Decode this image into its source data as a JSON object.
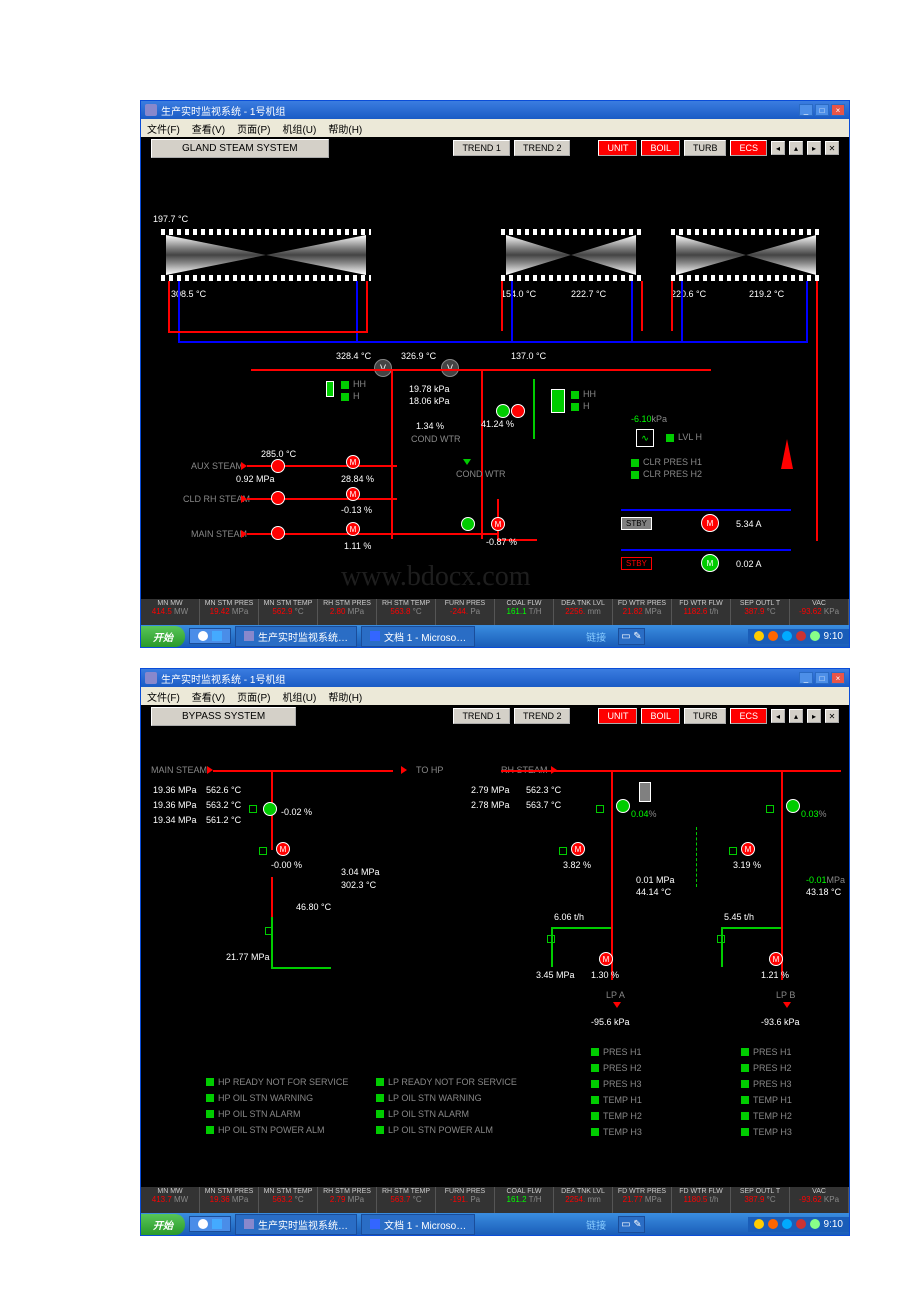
{
  "window_title": "生产实时监视系统 - 1号机组",
  "menu": {
    "file": "文件(F)",
    "view": "查看(V)",
    "page": "页面(P)",
    "unit": "机组(U)",
    "help": "帮助(H)"
  },
  "toolbar": {
    "trend1": "TREND 1",
    "trend2": "TREND 2",
    "unit": "UNIT",
    "boil": "BOIL",
    "turb": "TURB",
    "ecs": "ECS"
  },
  "screen1": {
    "title": "GLAND STEAM  SYSTEM",
    "t_hp_in": "197.7",
    "t_hp_out": "308.5",
    "t_ip1": "154.0",
    "t_ip2": "222.7",
    "t_lp1": "220.6",
    "t_lp2": "219.2",
    "t_hdr1": "328.4",
    "t_hdr2": "326.9",
    "t_hdr3": "137.0",
    "p1": "19.78",
    "p2": "18.06",
    "pct1": "1.34",
    "pct2": "41.24",
    "cond_wtr": "COND WTR",
    "aux_steam": "AUX STEAM",
    "aux_t": "285.0",
    "aux_p": "0.92",
    "aux_pct": "28.84",
    "cld_rh": "CLD RH STEAM",
    "cld_pct": "-0.13",
    "main_steam": "MAIN STEAM",
    "main_pct": "1.11",
    "main_pct2": "-0.87",
    "vac_p": "-6.10",
    "ind_hh": "HH",
    "ind_h": "H",
    "ind_lvlh": "LVL H",
    "ind_clr1": "CLR PRES H1",
    "ind_clr2": "CLR PRES H2",
    "stby": "STBY",
    "a1": "5.34",
    "a2": "0.02"
  },
  "status1": {
    "cols": [
      {
        "h": "MN MW",
        "v": "414.5",
        "u": "MW"
      },
      {
        "h": "MN STM PRES",
        "v": "19.42",
        "u": "MPa"
      },
      {
        "h": "MN STM TEMP",
        "v": "562.9",
        "u": "°C"
      },
      {
        "h": "RH STM PRES",
        "v": "2.80",
        "u": "MPa"
      },
      {
        "h": "RH STM TEMP",
        "v": "563.8",
        "u": "°C"
      },
      {
        "h": "FURN PRES",
        "v": "-244.",
        "u": "Pa"
      },
      {
        "h": "COAL FLW",
        "v": "161.1",
        "u": "T/H",
        "g": true
      },
      {
        "h": "DEA TNK LVL",
        "v": "2256.",
        "u": "mm"
      },
      {
        "h": "FD WTR PRES",
        "v": "21.82",
        "u": "MPa"
      },
      {
        "h": "FD WTR FLW",
        "v": "1182.6",
        "u": "t/h"
      },
      {
        "h": "SEP OUTL T",
        "v": "387.9",
        "u": "°C"
      },
      {
        "h": "VAC",
        "v": "-93.62",
        "u": "KPa"
      }
    ]
  },
  "screen2": {
    "title": "BYPASS  SYSTEM",
    "main_steam": "MAIN STEAM",
    "to_hp": "TO HP",
    "rh_steam": "RH STEAM",
    "ms_p1": "19.36",
    "ms_t1": "562.6",
    "ms_p2": "19.36",
    "ms_t2": "563.2",
    "ms_p3": "19.34",
    "ms_t3": "561.2",
    "hp_pct": "-0.02",
    "hp_m_pct": "-0.00",
    "hp_out_p": "3.04",
    "hp_out_t": "302.3",
    "hp_out_t2": "46.80",
    "hp_btm_p": "21.77",
    "rh_p1": "2.79",
    "rh_t1": "562.3",
    "rh_p2": "2.78",
    "rh_t2": "563.7",
    "lpa_pct": "0.04",
    "lpb_pct": "0.03",
    "lpa_m": "3.82",
    "lpb_m": "3.19",
    "lpa_p": "0.01",
    "lpa_t": "44.14",
    "lpb_p": "-0.01",
    "lpb_t": "43.18",
    "lpa_f": "6.06",
    "lpb_f": "5.45",
    "lpa_hdr": "3.45",
    "lpa_hdr_pct": "1.30",
    "lpb_hdr_pct": "1.21",
    "lpa_label": "LP A",
    "lpb_label": "LP B",
    "lpa_vac": "-95.6",
    "lpb_vac": "-93.6",
    "hp_ind": [
      "HP READY NOT FOR SERVICE",
      "HP OIL STN WARNING",
      "HP OIL STN ALARM",
      "HP OIL STN POWER ALM"
    ],
    "lp_ind": [
      "LP READY NOT FOR SERVICE",
      "LP OIL STN WARNING",
      "LP OIL STN ALARM",
      "LP OIL STN POWER ALM"
    ],
    "lpa_pres": [
      "PRES H1",
      "PRES H2",
      "PRES H3",
      "TEMP H1",
      "TEMP H2",
      "TEMP H3"
    ],
    "lpb_pres": [
      "PRES H1",
      "PRES H2",
      "PRES H3",
      "TEMP H1",
      "TEMP H2",
      "TEMP H3"
    ]
  },
  "status2": {
    "cols": [
      {
        "h": "MN MW",
        "v": "413.7",
        "u": "MW"
      },
      {
        "h": "MN STM PRES",
        "v": "19.36",
        "u": "MPa"
      },
      {
        "h": "MN STM TEMP",
        "v": "563.2",
        "u": "°C"
      },
      {
        "h": "RH STM PRES",
        "v": "2.79",
        "u": "MPa"
      },
      {
        "h": "RH STM TEMP",
        "v": "563.7",
        "u": "°C"
      },
      {
        "h": "FURN PRES",
        "v": "-191.",
        "u": "Pa"
      },
      {
        "h": "COAL FLW",
        "v": "161.2",
        "u": "T/H",
        "g": true
      },
      {
        "h": "DEA TNK LVL",
        "v": "2254.",
        "u": "mm"
      },
      {
        "h": "FD WTR PRES",
        "v": "21.77",
        "u": "MPa"
      },
      {
        "h": "FD WTR FLW",
        "v": "1180.5",
        "u": "t/h"
      },
      {
        "h": "SEP OUTL T",
        "v": "387.9",
        "u": "°C"
      },
      {
        "h": "VAC",
        "v": "-93.62",
        "u": "KPa"
      }
    ]
  },
  "taskbar": {
    "start": "开始",
    "items": [
      "生产实时监视系统…",
      "文档 1 - Microso…"
    ],
    "conn": "链接",
    "time": "9:10"
  },
  "units": {
    "c": "°C",
    "mpa": "MPa",
    "kpa": "kPa",
    "pct": "%",
    "a": "A",
    "mw": "MW",
    "th": "t/h"
  }
}
